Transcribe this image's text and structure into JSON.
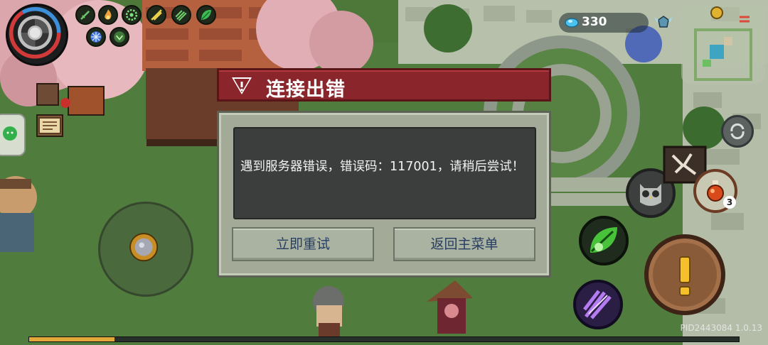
{
  "dialog": {
    "title": "连接出错",
    "message": "遇到服务器错误，错误码：117001，请稍后尝试！",
    "retry_label": "立即重试",
    "menu_label": "返回主菜单",
    "title_color": "#8a262b"
  },
  "hud": {
    "gem_count": "330",
    "version": "PID2443084 1.0.13",
    "xp_fraction": 0.12,
    "potion_count": "3"
  },
  "icons": {
    "portrait": "spiral-portrait-icon",
    "minimap": "minimap-icon",
    "joystick": "joystick-knob-icon",
    "attack": "exclamation-attack-icon",
    "skill_leaf": "leaf-skill-icon",
    "skill_purple": "purple-claw-skill-icon",
    "pet": "owl-pet-icon",
    "potion": "potion-icon",
    "swap": "swap-icon",
    "chat": "chat-icon",
    "quest": "quest-scroll-icon"
  }
}
